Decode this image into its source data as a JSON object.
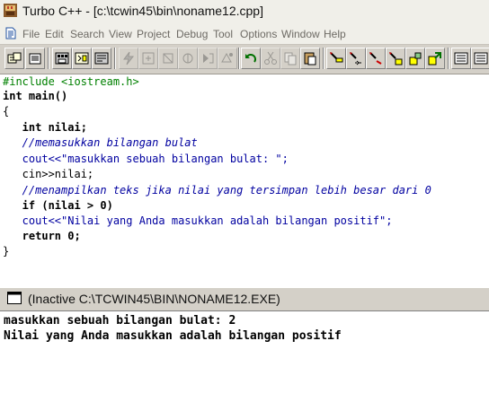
{
  "window": {
    "title": "Turbo C++ - [c:\\tcwin45\\bin\\noname12.cpp]"
  },
  "menu": [
    "File",
    "Edit",
    "Search",
    "View",
    "Project",
    "Debug",
    "Tool",
    "Options",
    "Window",
    "Help"
  ],
  "toolbar": {
    "buttons": [
      "open-project-icon",
      "open-file-icon",
      "save-icon",
      "cut-icon",
      "copy-icon",
      "paste-icon",
      "print-icon",
      "compile-icon",
      "make-icon",
      "build-icon",
      "debug-icon",
      "run-icon",
      "undo-icon",
      "cut-tool-icon",
      "copy-tool-icon",
      "paste-tool-icon",
      "find-icon",
      "search-icon",
      "replace-icon",
      "browse-icon",
      "go-icon",
      "bookmark-icon",
      "tool-icon",
      "view-icon",
      "window-icon"
    ]
  },
  "editor": {
    "lines": [
      "#include <iostream.h>",
      "int main()",
      "{",
      "   int nilai;",
      "   //memasukkan bilangan bulat",
      "   cout<<\"masukkan sebuah bilangan bulat: \";",
      "   cin>>nilai;",
      "   //menampilkan teks jika nilai yang tersimpan lebih besar dari 0",
      "   if (nilai > 0)",
      "   cout<<\"Nilai yang Anda masukkan adalah bilangan positif\";",
      "   return 0;",
      "}"
    ]
  },
  "console": {
    "title": "(Inactive C:\\TCWIN45\\BIN\\NONAME12.EXE)",
    "output": [
      "masukkan sebuah bilangan bulat: 2",
      "Nilai yang Anda masukkan adalah bilangan positif"
    ]
  }
}
